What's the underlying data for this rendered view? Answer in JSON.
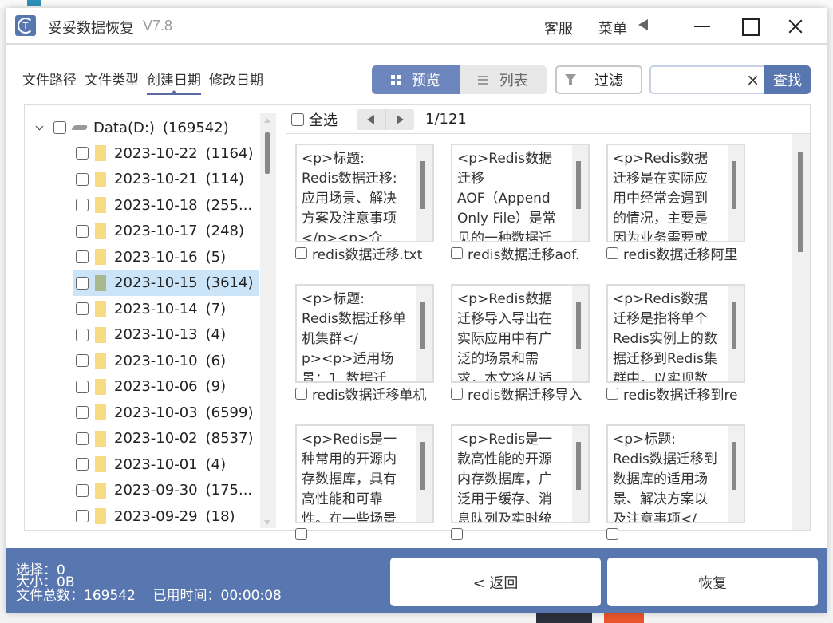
{
  "window": {
    "app_name": "妥妥数据恢复",
    "version": "V7.8",
    "logo_text": "T",
    "service_label": "客服",
    "menu_label": "菜单"
  },
  "tabs": [
    {
      "label": "文件路径",
      "active": false
    },
    {
      "label": "文件类型",
      "active": false
    },
    {
      "label": "创建日期",
      "active": true
    },
    {
      "label": "修改日期",
      "active": false
    }
  ],
  "toolbar": {
    "preview_label": "预览",
    "list_label": "列表",
    "filter_label": "过滤",
    "search_value": "",
    "search_clear": "×",
    "search_button": "查找"
  },
  "tree": {
    "root": {
      "label": "Data(D:)",
      "count": "(169542)"
    },
    "items": [
      {
        "date": "2023-10-22",
        "count": "(1164)"
      },
      {
        "date": "2023-10-21",
        "count": "(114)"
      },
      {
        "date": "2023-10-18",
        "count": "(255..."
      },
      {
        "date": "2023-10-17",
        "count": "(248)"
      },
      {
        "date": "2023-10-16",
        "count": "(5)"
      },
      {
        "date": "2023-10-15",
        "count": "(3614)",
        "selected": true
      },
      {
        "date": "2023-10-14",
        "count": "(7)"
      },
      {
        "date": "2023-10-13",
        "count": "(4)"
      },
      {
        "date": "2023-10-10",
        "count": "(6)"
      },
      {
        "date": "2023-10-06",
        "count": "(9)"
      },
      {
        "date": "2023-10-03",
        "count": "(6599)"
      },
      {
        "date": "2023-10-02",
        "count": "(8537)"
      },
      {
        "date": "2023-10-01",
        "count": "(4)"
      },
      {
        "date": "2023-09-30",
        "count": "(175..."
      },
      {
        "date": "2023-09-29",
        "count": "(18)"
      }
    ]
  },
  "file_list": {
    "select_all_label": "全选",
    "page_indicator": "1/121",
    "files": [
      {
        "preview": "<p>标题:\nRedis数据迁移:\n应用场景、解决\n方案及注意事项\n</p><p>介",
        "name": "redis数据迁移.txt"
      },
      {
        "preview": "<p>Redis数据\n迁移\nAOF（Append\nOnly File）是常\n见的一种数据迁",
        "name": "redis数据迁移aof."
      },
      {
        "preview": "<p>Redis数据\n迁移是在实际应\n用中经常会遇到\n的情况，主要是\n因为业务需要或",
        "name": "redis数据迁移阿里"
      },
      {
        "preview": "<p>标题:\nRedis数据迁移单\n机集群</\np><p>适用场\n景：1. 数据迁",
        "name": "redis数据迁移单机"
      },
      {
        "preview": "<p>Redis数据\n迁移导入导出在\n实际应用中有广\n泛的场景和需\n求，本文将从适",
        "name": "redis数据迁移导入"
      },
      {
        "preview": "<p>Redis数据\n迁移是指将单个\nRedis实例上的数\n据迁移到Redis集\n群中，以实现数",
        "name": "redis数据迁移到re"
      },
      {
        "preview": "<p>Redis是一\n种常用的开源内\n存数据库，具有\n高性能和可靠\n性。在一些场景",
        "name": ""
      },
      {
        "preview": "<p>Redis是一\n款高性能的开源\n内存数据库，广\n泛用于缓存、消\n息队列及实时统",
        "name": ""
      },
      {
        "preview": "<p>标题:\nRedis数据迁移到\n数据库的适用场\n景、解决方案以\n及注意事项</",
        "name": ""
      }
    ]
  },
  "footer": {
    "selected": "选择：0",
    "size": "大小：0B",
    "total": "文件总数：169542    已用时间：00:00:08",
    "back_button": "< 返回",
    "recover_button": "恢复"
  },
  "colors": {
    "accent": "#5877b1",
    "preview_active": "#6d86bd",
    "selected_row": "#cce4f7",
    "folder": "#f7dc83"
  }
}
